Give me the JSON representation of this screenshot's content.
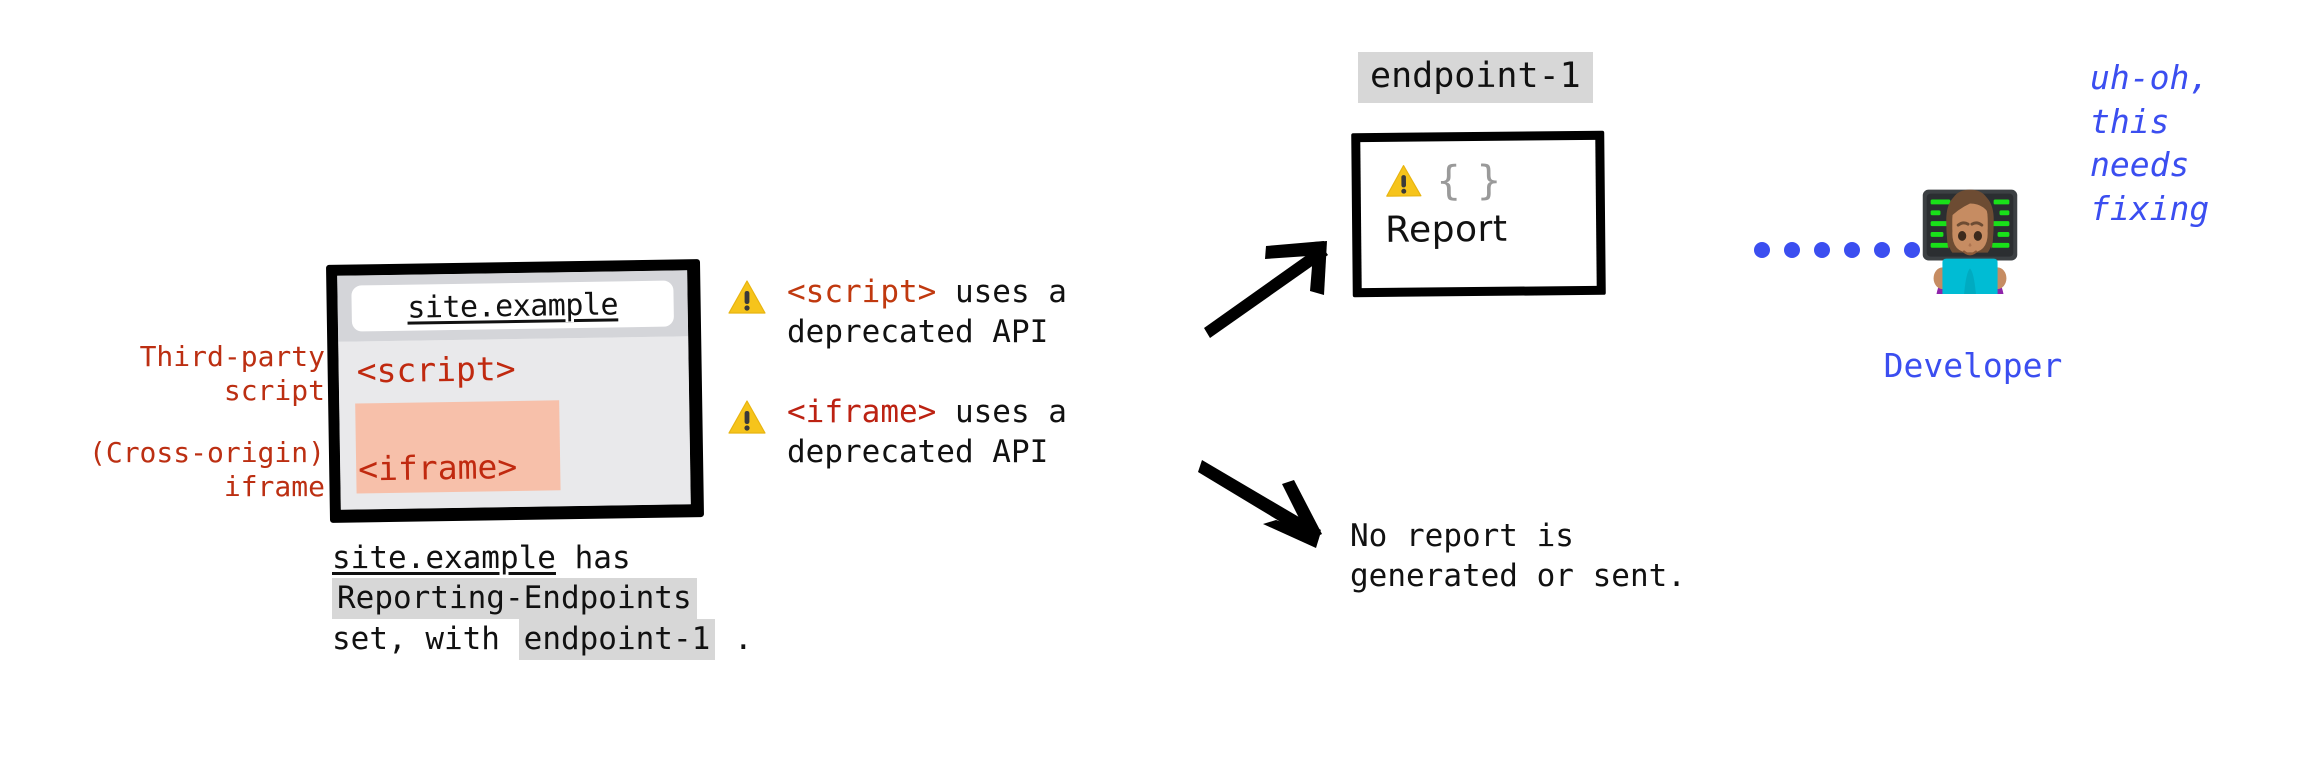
{
  "diagram": {
    "title": "Reporting-Endpoints cross-origin iframe report delivery",
    "colors": {
      "red_label": "#bc2f12",
      "code_red": "#c0290f",
      "code_bg_gray": "#d7d7d7",
      "iframe_highlight": "#f7c0aa",
      "browser_chrome": "#d4d5d9",
      "browser_body": "#e9e9eb",
      "blue_accent": "#3b4ef0",
      "warning_yellow": "#f6c41b",
      "outline_black": "#000000"
    }
  },
  "annotations": {
    "script_label": "Third-party\nscript",
    "iframe_label": "(Cross-origin)\niframe"
  },
  "browser": {
    "url": "site.example",
    "script_tag": "<script>",
    "iframe_tag": "<iframe>"
  },
  "caption": {
    "line1_code": "site.example",
    "line1_rest": "has",
    "line2_code": "Reporting-Endpoints",
    "line3_pre": "set, with",
    "line3_code": "endpoint-1",
    "line3_post": "."
  },
  "warnings": [
    {
      "icon": "warning-triangle-icon",
      "tag": "<script>",
      "text": " uses a\ndeprecated API",
      "text_line1": " uses a",
      "text_line2": "deprecated API"
    },
    {
      "icon": "warning-triangle-icon",
      "tag": "<iframe>",
      "text_line1": " uses a",
      "text_line2": "deprecated API"
    }
  ],
  "endpoint": {
    "pill_label": "endpoint-1",
    "report_braces": "{ }",
    "report_label": "Report",
    "report_icon": "warning-triangle-icon"
  },
  "no_report": {
    "text": "No report is\ngenerated or sent."
  },
  "developer": {
    "emoji_name": "woman-technologist-emoji",
    "label": "Developer",
    "speech": "uh-oh,\nthis\nneeds\nfixing",
    "dot_count": 6
  }
}
